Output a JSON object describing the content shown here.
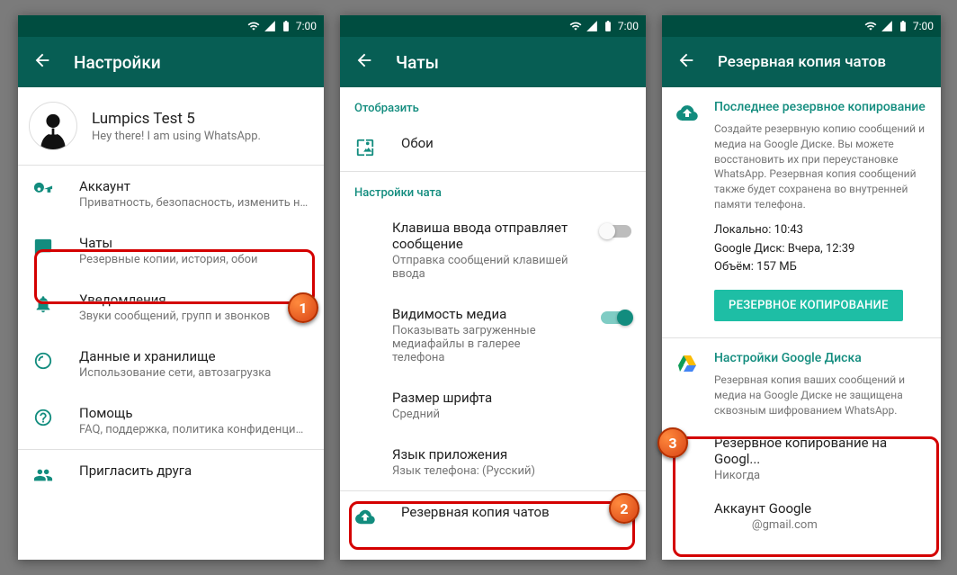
{
  "status": {
    "time": "7:00"
  },
  "screen1": {
    "title": "Настройки",
    "profile": {
      "name": "Lumpics Test 5",
      "status": "Hey there! I am using WhatsApp."
    },
    "items": [
      {
        "title": "Аккаунт",
        "sub": "Приватность, безопасность, изменить но..."
      },
      {
        "title": "Чаты",
        "sub": "Резервные копии, история, обои"
      },
      {
        "title": "Уведомления",
        "sub": "Звуки сообщений, групп и звонков"
      },
      {
        "title": "Данные и хранилище",
        "sub": "Использование сети, автозагрузка"
      },
      {
        "title": "Помощь",
        "sub": "FAQ, поддержка, политика конфиденциал..."
      },
      {
        "title": "Пригласить друга",
        "sub": ""
      }
    ]
  },
  "screen2": {
    "title": "Чаты",
    "section_display": "Отобразить",
    "wallpaper": "Обои",
    "section_chat": "Настройки чата",
    "enter": {
      "title": "Клавиша ввода отправляет сообщение",
      "sub": "Отправка сообщений клавишей ввода"
    },
    "media": {
      "title": "Видимость медиа",
      "sub": "Показывать загруженные медиафайлы в галерее телефона"
    },
    "font": {
      "title": "Размер шрифта",
      "sub": "Средний"
    },
    "lang": {
      "title": "Язык приложения",
      "sub": "Язык телефона: (Русский)"
    },
    "backup": "Резервная копия чатов"
  },
  "screen3": {
    "title": "Резервная копия чатов",
    "last_header": "Последнее резервное копирование",
    "desc": "Создайте резервную копию сообщений и медиа на Google Диске. Вы можете восстановить их при переустановке WhatsApp. Резервная копия сообщений также будет сохранена во внутренней памяти телефона.",
    "local": "Локально: 10:43",
    "gdrive": "Google Диск: Вчера, 12:39",
    "size": "Объём: 157 МБ",
    "button": "РЕЗЕРВНОЕ КОПИРОВАНИЕ",
    "gsection": "Настройки Google Диска",
    "gdesc": "Резервная копия ваших сообщений и медиа на Google Диске не защищена сквозным шифрованием WhatsApp.",
    "freq_t": "Резервное копирование на Googl...",
    "freq_v": "Никогда",
    "acc_t": "Аккаунт Google",
    "acc_v": "             @gmail.com"
  },
  "markers": {
    "m1": "1",
    "m2": "2",
    "m3": "3"
  }
}
